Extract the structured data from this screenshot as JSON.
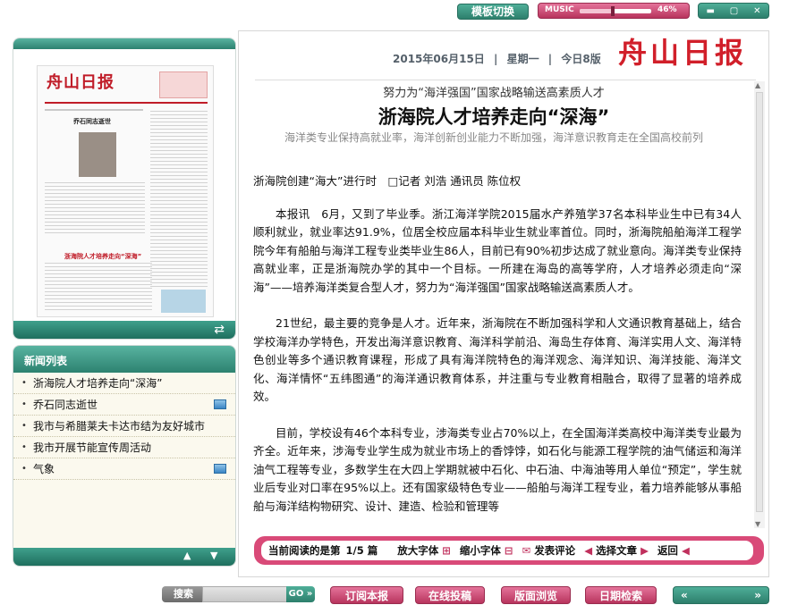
{
  "topbar": {
    "template_switch": "模板切换",
    "music_label": "MUSIC",
    "music_volume": "46%",
    "music_volume_fraction": 0.46
  },
  "thumbnail": {
    "paper_logo": "舟山日报",
    "headline_small": "乔石同志逝世",
    "headline_lead": "浙海院人才培养走向“深海”"
  },
  "news_list": {
    "header": "新闻列表",
    "items": [
      {
        "label": "浙海院人才培养走向“深海”",
        "has_image": false
      },
      {
        "label": "乔石同志逝世",
        "has_image": true
      },
      {
        "label": "我市与希腊莱夫卡达市结为友好城市",
        "has_image": false
      },
      {
        "label": "我市开展节能宣传周活动",
        "has_image": false
      },
      {
        "label": "气象",
        "has_image": true
      }
    ]
  },
  "article": {
    "date": "2015年06月15日",
    "weekday": "星期一",
    "edition": "今日8版",
    "logo": "舟山日报",
    "pretitle": "努力为“海洋强国”国家战略输送高素质人才",
    "title": "浙海院人才培养走向“深海”",
    "subtitle": "海洋类专业保持高就业率，海洋创新创业能力不断加强，海洋意识教育走在全国高校前列",
    "byline": "浙海院创建“海大”进行时　□记者 刘浩 通讯员 陈位权",
    "paragraphs": [
      "本报讯　6月，又到了毕业季。浙江海洋学院2015届水产养殖学37名本科毕业生中已有34人顺利就业，就业率达91.9%，位居全校应届本科毕业生就业率首位。同时，浙海院船舶海洋工程学院今年有船舶与海洋工程专业类毕业生86人，目前已有90%初步达成了就业意向。海洋类专业保持高就业率，正是浙海院办学的其中一个目标。一所建在海岛的高等学府，人才培养必须走向“深海”——培养海洋类复合型人才，努力为“海洋强国”国家战略输送高素质人才。",
      "21世纪，最主要的竞争是人才。近年来，浙海院在不断加强科学和人文通识教育基础上，结合学校海洋办学特色，开发出海洋意识教育、海洋科学前沿、海岛生存体育、海洋实用人文、海洋特色创业等多个通识教育课程，形成了具有海洋院特色的海洋观念、海洋知识、海洋技能、海洋文化、海洋情怀“五纬图通”的海洋通识教育体系，并注重与专业教育相融合，取得了显著的培养成效。",
      "目前，学校设有46个本科专业，涉海类专业占70%以上，在全国海洋类高校中海洋类专业最为齐全。近年来，涉海专业学生成为就业市场上的香饽饽，如石化与能源工程学院的油气储运和海洋油气工程等专业，多数学生在大四上学期就被中石化、中石油、中海油等用人单位“预定”，学生就业后专业对口率在95%以上。还有国家级特色专业——船舶与海洋工程专业，着力培养能够从事船舶与海洋结构物研究、设计、建造、检验和管理等"
    ]
  },
  "reading_bar": {
    "current_label": "当前阅读的是第",
    "current": "1/5",
    "unit": "篇",
    "enlarge": "放大字体",
    "shrink": "缩小字体",
    "comment": "发表评论",
    "select": "选择文章",
    "back": "返回"
  },
  "bottombar": {
    "search_label": "搜索",
    "go": "GO",
    "subscribe": "订阅本报",
    "submit": "在线投稿",
    "browse": "版面浏览",
    "date_search": "日期检索"
  }
}
